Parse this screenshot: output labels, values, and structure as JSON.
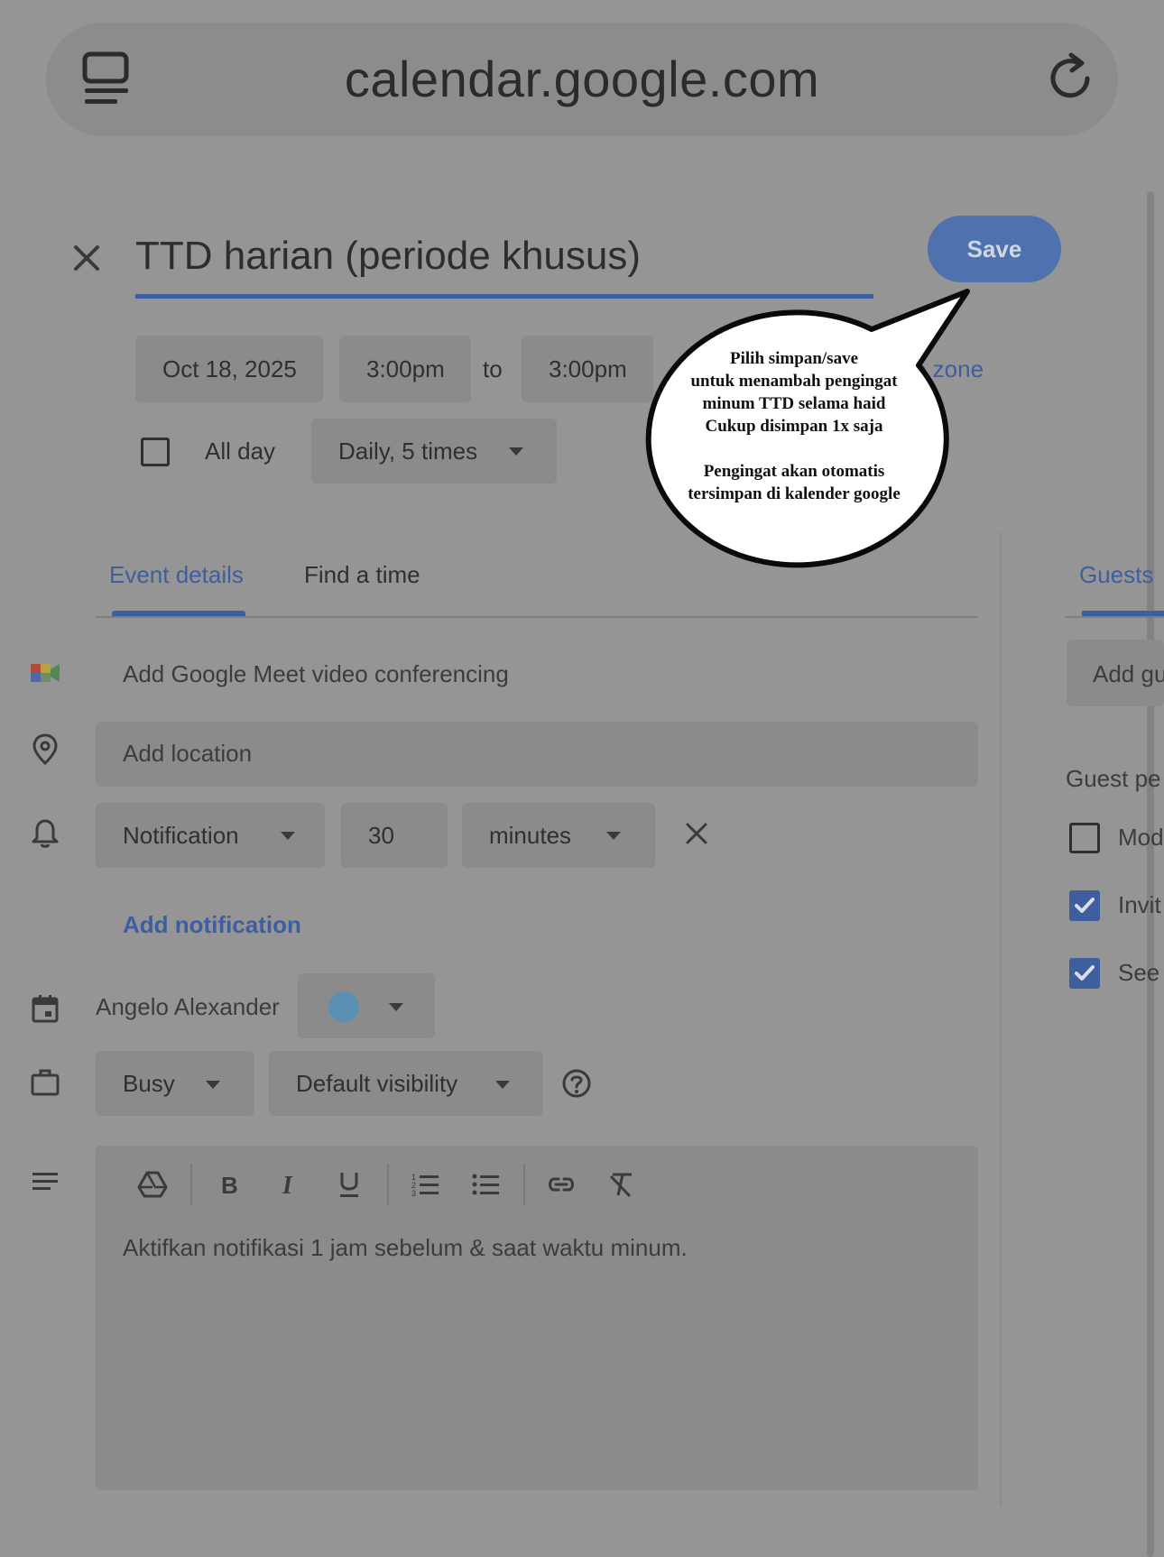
{
  "browser": {
    "url": "calendar.google.com"
  },
  "event": {
    "title": "TTD harian (periode khusus)",
    "save_label": "Save",
    "date": "Oct 18, 2025",
    "start_time": "3:00pm",
    "to_label": "to",
    "end_time": "3:00pm",
    "time_zone_label": "e zone",
    "all_day_label": "All day",
    "repeat": "Daily, 5 times"
  },
  "tabs": {
    "event_details": "Event details",
    "find_a_time": "Find a time",
    "guests": "Guests"
  },
  "details": {
    "meet_label": "Add Google Meet video conferencing",
    "location_placeholder": "Add location",
    "notification_type": "Notification",
    "notification_value": "30",
    "notification_unit": "minutes",
    "add_notification": "Add notification",
    "calendar_owner": "Angelo Alexander",
    "calendar_color": "#5b8fb3",
    "availability": "Busy",
    "visibility": "Default visibility",
    "description": "Aktifkan notifikasi 1 jam sebelum & saat waktu minum."
  },
  "guests_panel": {
    "add_guests_placeholder": "Add gu",
    "permissions_label": "Guest pe",
    "permissions": [
      {
        "label": "Mod",
        "checked": false
      },
      {
        "label": "Invit",
        "checked": true
      },
      {
        "label": "See",
        "checked": true
      }
    ]
  },
  "annotation": {
    "text": "Pilih simpan/save\nuntuk menambah pengingat\nminum TTD selama haid\nCukup disimpan 1x saja\n\nPengingat akan otomatis\ntersimpan di kalender google"
  },
  "colors": {
    "accent": "#3e5ea0",
    "save_button": "#4f71ad",
    "overlay_background": "#959595"
  }
}
